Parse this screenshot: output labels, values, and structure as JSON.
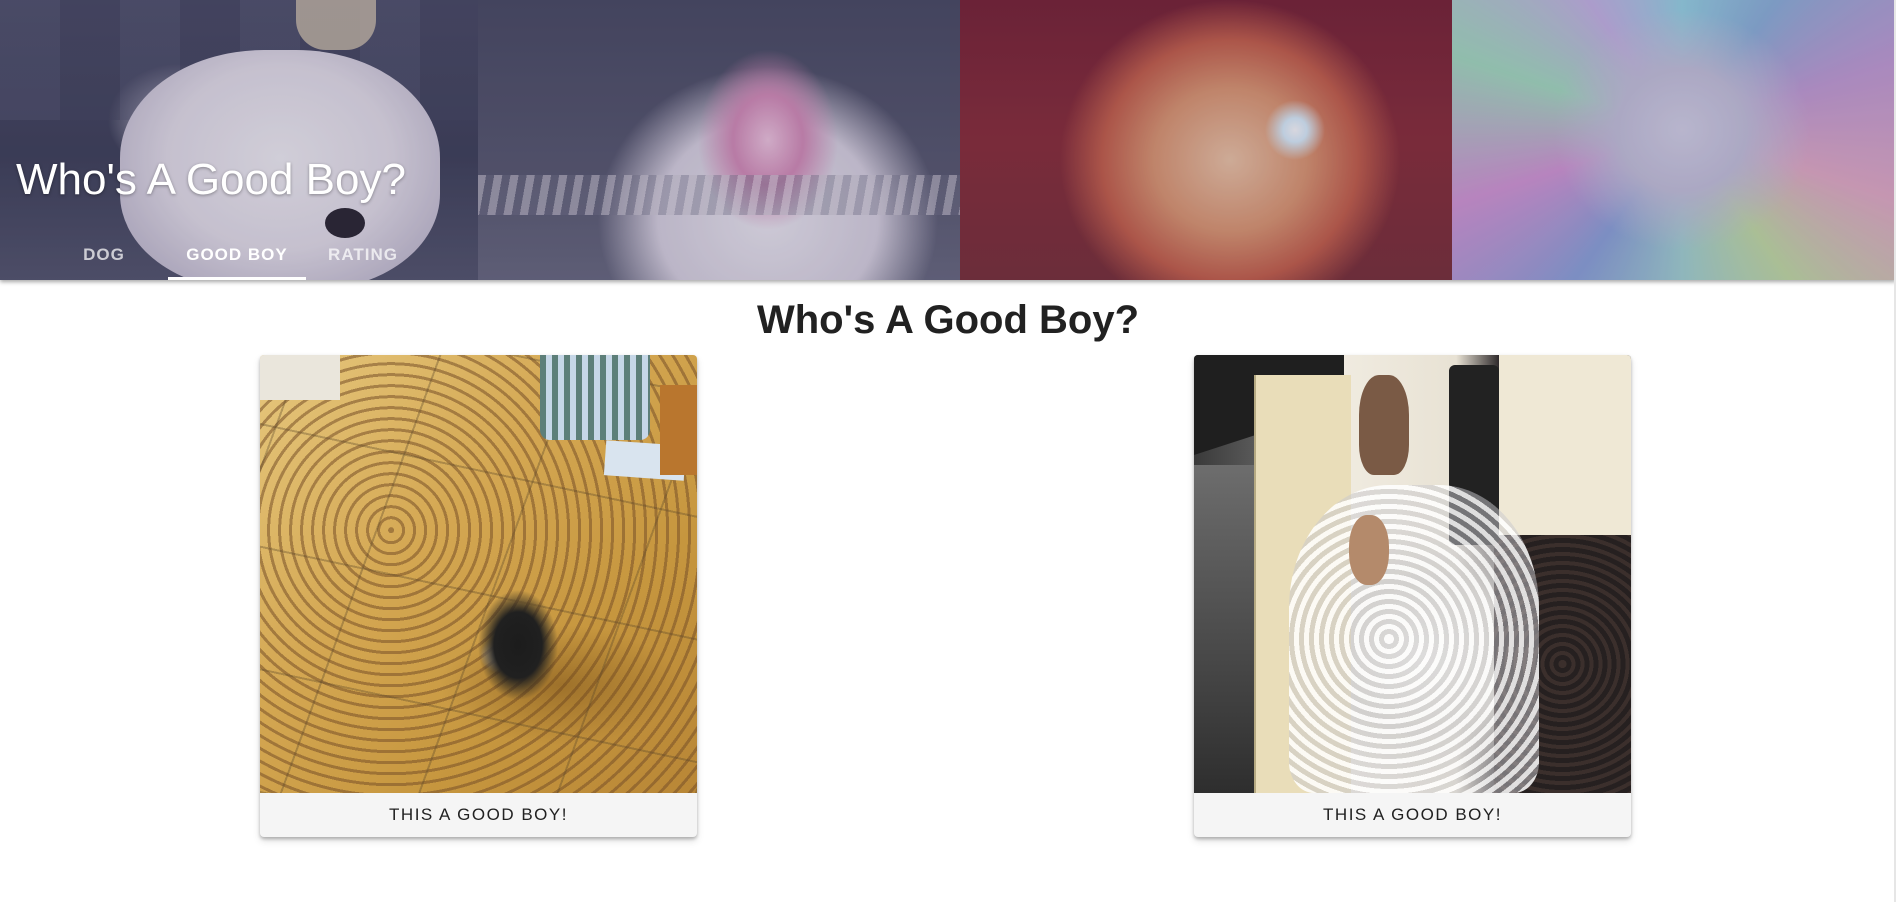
{
  "app_bar": {
    "title": "Who's A Good Boy?",
    "tabs": [
      {
        "label": "DOG",
        "active": false
      },
      {
        "label": "GOOD BOY",
        "active": true
      },
      {
        "label": "RATING",
        "active": false
      }
    ]
  },
  "main": {
    "heading": "Who's A Good Boy?",
    "cards": [
      {
        "image": "dog-with-scattered-kibble-photo",
        "button_label": "THIS A GOOD BOY!"
      },
      {
        "image": "dogs-with-torn-pillow-feathers-photo",
        "button_label": "THIS A GOOD BOY!"
      }
    ]
  },
  "colors": {
    "title_text": "#ffffff",
    "active_tab_indicator": "#ffffff",
    "heading_text": "#212121",
    "card_caption_bg": "#f5f5f5"
  }
}
